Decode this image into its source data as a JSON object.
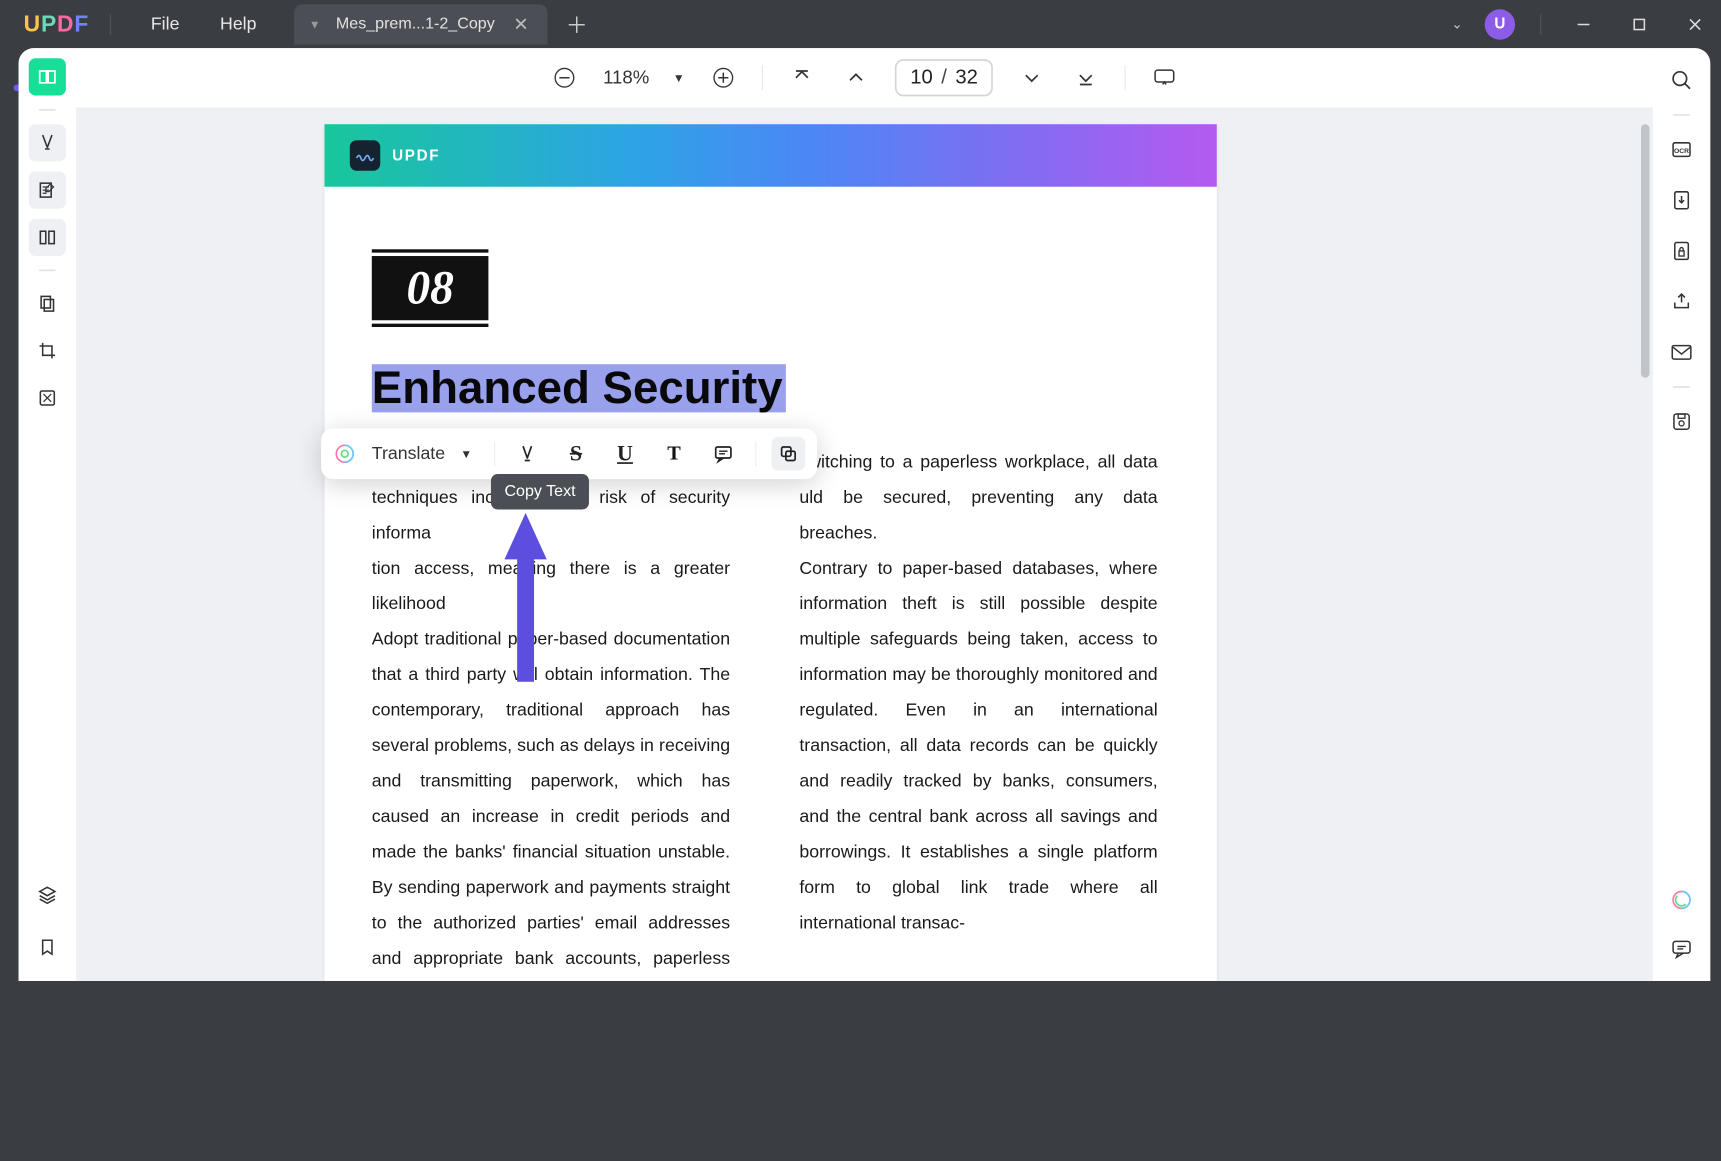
{
  "titlebar": {
    "menu_file": "File",
    "menu_help": "Help"
  },
  "tab": {
    "label": "Mes_prem...1-2_Copy"
  },
  "user": {
    "initial": "U"
  },
  "toolbar": {
    "zoom": "118%",
    "current_page": "10",
    "total_pages": "32"
  },
  "document": {
    "brand": "UPDF",
    "section_number": "08",
    "section_title": "Enhanced Security",
    "col_left": "Adopt traditional paper-based documentation that a third party will obtain information. The con­temporary, traditional approach has several prob­lems, such as delays in receiving and transmitting paperwork, which has caused an increase in credit periods and made the banks' financial situation unstable. By sending paperwork and payments straight to the authorized parties' email addresses and appropriate bank accounts, paperless bank-",
    "col_left_line2": "techniques increases the risk of security informa­",
    "col_left_line3": "tion access, meaning there is a greater likelihood",
    "col_right_top": "switching to a paperless workplace, all data",
    "col_right_line2": "uld be secured, preventing any data breaches.",
    "col_right": "Contrary to paper-based databases, where infor­mation theft is still possible despite multiple safe­guards being taken, access to information may be thoroughly monitored and regulated. Even in an international transaction, all data records can be quickly and readily tracked by banks, consumers, and the central bank across all savings and borrowings. It establishes a single platform form to global link trade where all international transac-"
  },
  "float_toolbar": {
    "translate": "Translate",
    "tooltip": "Copy Text"
  }
}
